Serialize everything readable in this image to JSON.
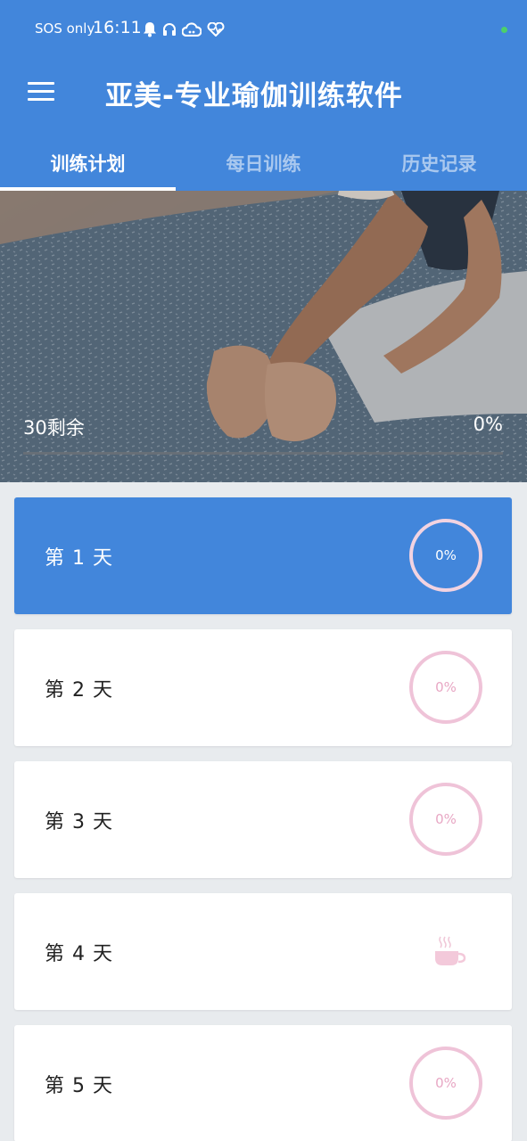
{
  "status_bar": {
    "carrier": "SOS only",
    "time": "16:11"
  },
  "app_bar": {
    "title": "亚美-专业瑜伽训练软件"
  },
  "tabs": [
    {
      "label": "训练计划",
      "active": true
    },
    {
      "label": "每日训练",
      "active": false
    },
    {
      "label": "历史记录",
      "active": false
    }
  ],
  "hero": {
    "remaining_label": "30剩余",
    "progress_label": "0%",
    "progress": 0
  },
  "days": [
    {
      "label": "第 1 天",
      "progress_label": "0%",
      "type": "progress-ring",
      "selected": true
    },
    {
      "label": "第 2 天",
      "progress_label": "0%",
      "type": "progress-ring",
      "selected": false
    },
    {
      "label": "第 3 天",
      "progress_label": "0%",
      "type": "progress-ring",
      "selected": false
    },
    {
      "label": "第 4 天",
      "type": "rest-day-cup-icon",
      "selected": false
    },
    {
      "label": "第 5 天",
      "progress_label": "0%",
      "type": "progress-ring",
      "selected": false
    }
  ],
  "colors": {
    "primary": "#4286db",
    "ring": "#efc3d8",
    "background": "#e8ebee"
  }
}
